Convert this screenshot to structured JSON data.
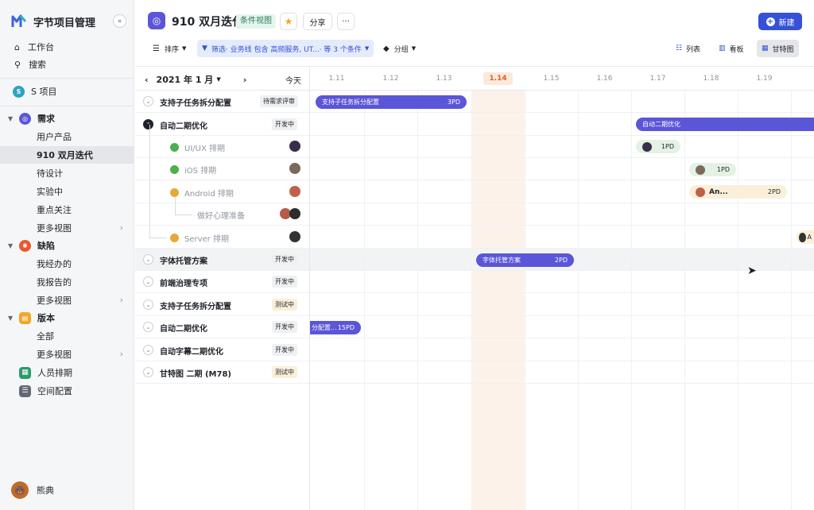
{
  "app": {
    "name": "字节项目管理"
  },
  "sidebar": {
    "top_items": [
      {
        "label": "工作台"
      },
      {
        "label": "搜索"
      }
    ],
    "project": {
      "label": "S 项目",
      "badge": "S"
    },
    "sections": {
      "requirement": {
        "label": "需求",
        "items": [
          "用户产品",
          "910 双月迭代",
          "待设计",
          "实验中",
          "重点关注",
          "更多视图"
        ]
      },
      "defect": {
        "label": "缺陷",
        "items": [
          "我经办的",
          "我报告的",
          "更多视图"
        ]
      },
      "version": {
        "label": "版本",
        "items": [
          "全部",
          "更多视图"
        ]
      },
      "people": {
        "label": "人员排期"
      },
      "space": {
        "label": "空间配置"
      }
    },
    "user": {
      "name": "熊典"
    },
    "colors": {
      "requirement": "#5b55d8",
      "defect": "#e8572f",
      "version": "#f0a828",
      "people": "#2c9b6b",
      "space": "#646a73"
    }
  },
  "header": {
    "title": "910 双月迭代",
    "view_tag": "条件视图",
    "share_label": "分享",
    "more_label": "···",
    "new_label": "新建",
    "toolbar": {
      "sort_label": "排序",
      "filter_label": "筛选· 业务线 包含 高频服务, UT...· 等 3 个条件",
      "group_label": "分组"
    },
    "views": [
      {
        "label": "列表"
      },
      {
        "label": "看板"
      },
      {
        "label": "甘特图"
      }
    ]
  },
  "timeline": {
    "month_label": "2021 年 1 月",
    "today_label": "今天",
    "dates": [
      "1.11",
      "1.12",
      "1.13",
      "1.14",
      "1.15",
      "1.16",
      "1.17",
      "1.18",
      "1.19"
    ],
    "today_date": "1.14"
  },
  "rows": [
    {
      "title": "支持子任务拆分配置",
      "status": "待需求评审"
    },
    {
      "title": "自动二期优化",
      "status": "开发中"
    },
    {
      "title": "UI/UX 排期"
    },
    {
      "title": "iOS 排期"
    },
    {
      "title": "Android 排期"
    },
    {
      "title": "做好心理准备"
    },
    {
      "title": "Server 排期"
    },
    {
      "title": "字体托管方案",
      "status": "开发中"
    },
    {
      "title": "前端治理专项",
      "status": "开发中"
    },
    {
      "title": "支持子任务拆分配置",
      "status": "测试中"
    },
    {
      "title": "自动二期优化",
      "status": "开发中"
    },
    {
      "title": "自动字幕二期优化",
      "status": "开发中"
    },
    {
      "title": "甘特图 二期 (M78)",
      "status": "测试中"
    }
  ],
  "bars": [
    {
      "label": "支持子任务拆分配置",
      "pd": "3PD"
    },
    {
      "label": "自动二期优化",
      "pd": ""
    },
    {
      "label": "",
      "pd": "1PD"
    },
    {
      "label": "",
      "pd": "1PD"
    },
    {
      "label": "An...",
      "pd": "2PD"
    },
    {
      "label": "A",
      "pd": ""
    },
    {
      "label": "字体托管方案",
      "pd": "2PD"
    },
    {
      "label": "分配置...",
      "pd": "15PD"
    }
  ]
}
